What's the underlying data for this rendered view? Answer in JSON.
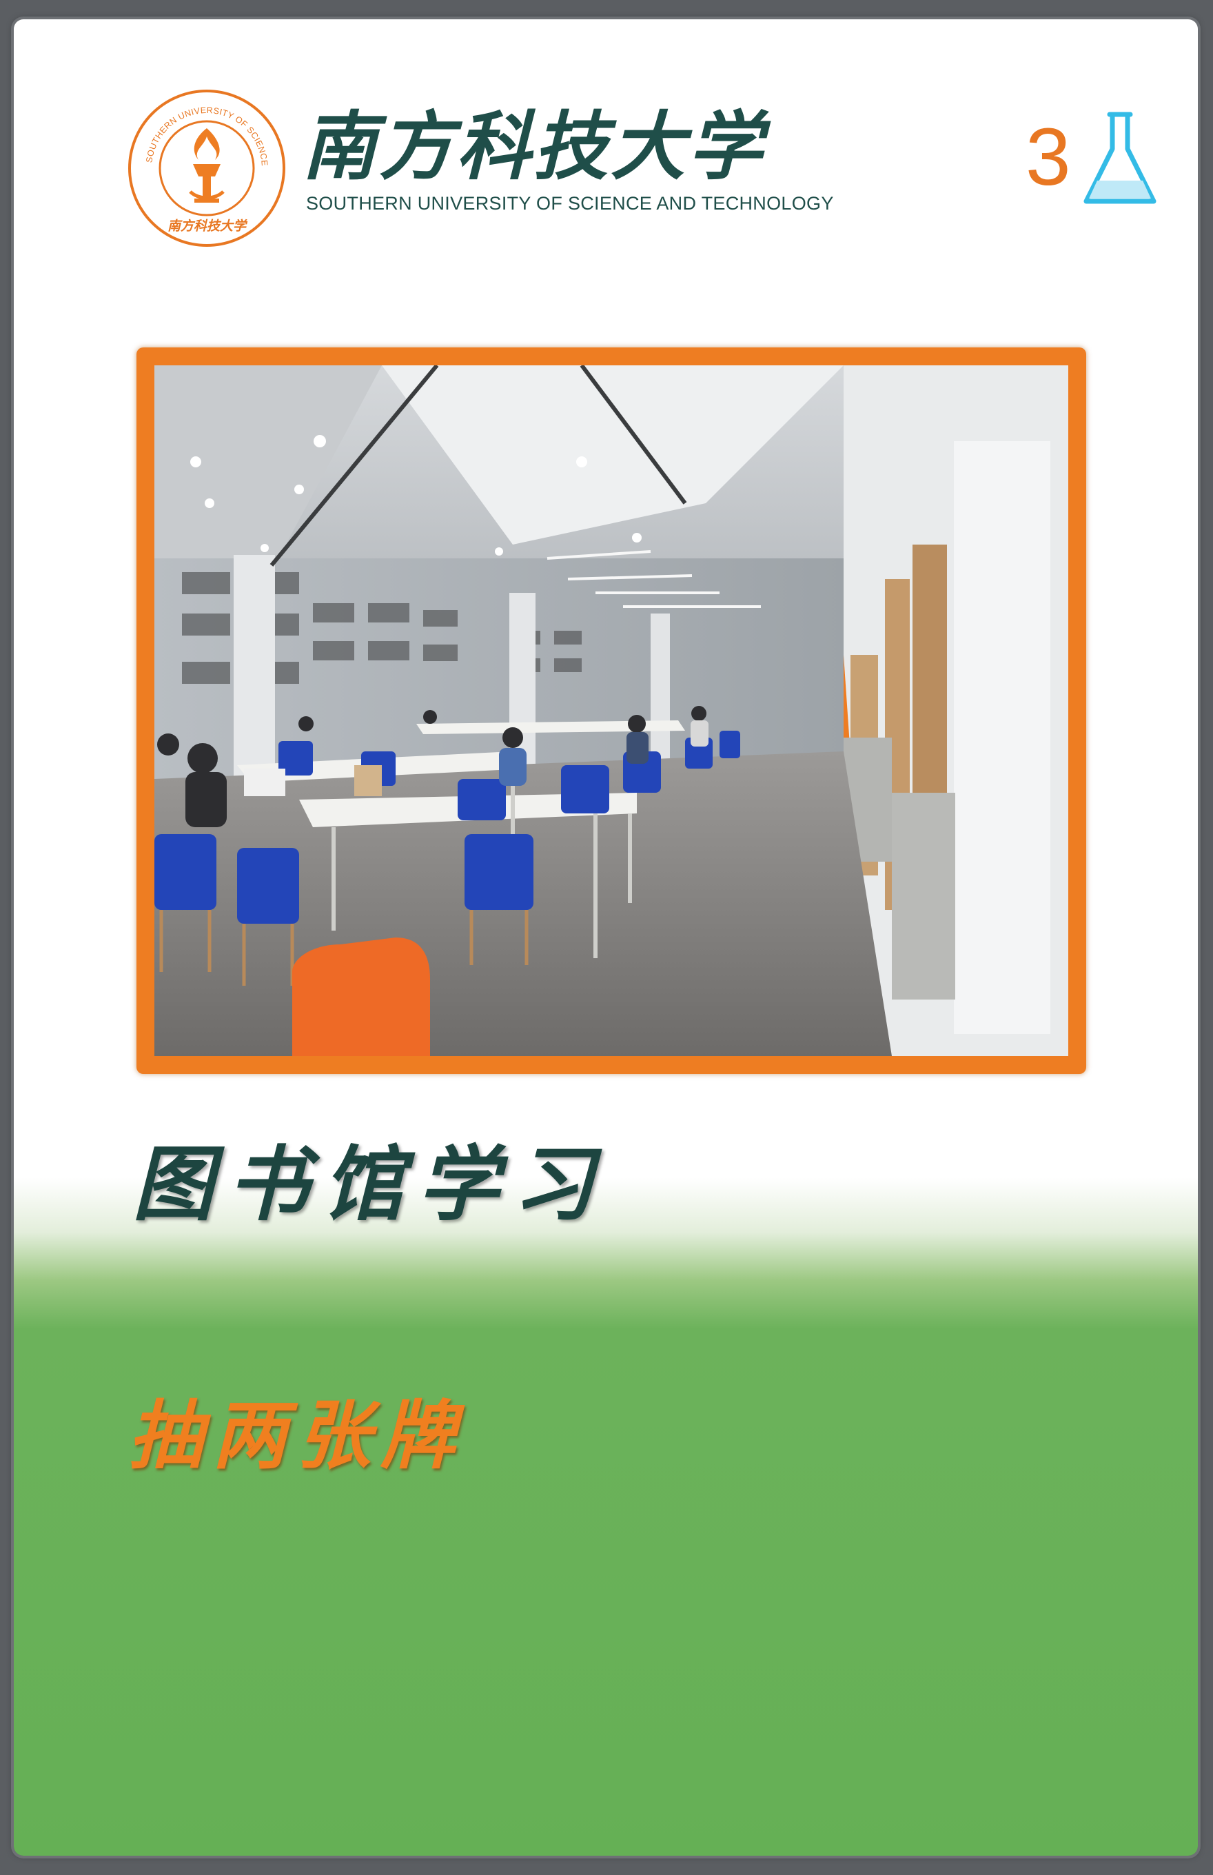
{
  "brand": {
    "name_cn": "南方科技大学",
    "name_en": "SOUTHERN UNIVERSITY OF SCIENCE AND TECHNOLOGY",
    "seal_ring_text": "SOUTHERN UNIVERSITY OF SCIENCE AND TECHNOLOGY",
    "seal_bottom_text": "南方科技大学",
    "seal_icon": "torch-icon",
    "color_primary": "#e87722",
    "color_text": "#1f4e49"
  },
  "card": {
    "level": "3",
    "level_icon": "flask-icon",
    "photo_subject": "library-study-hall",
    "title": "图书馆学习",
    "action": "抽两张牌",
    "colors": {
      "frame": "#ee7d22",
      "bottom_panel": "#65b055",
      "title": "#1d4540",
      "action": "#f07f1f"
    }
  }
}
